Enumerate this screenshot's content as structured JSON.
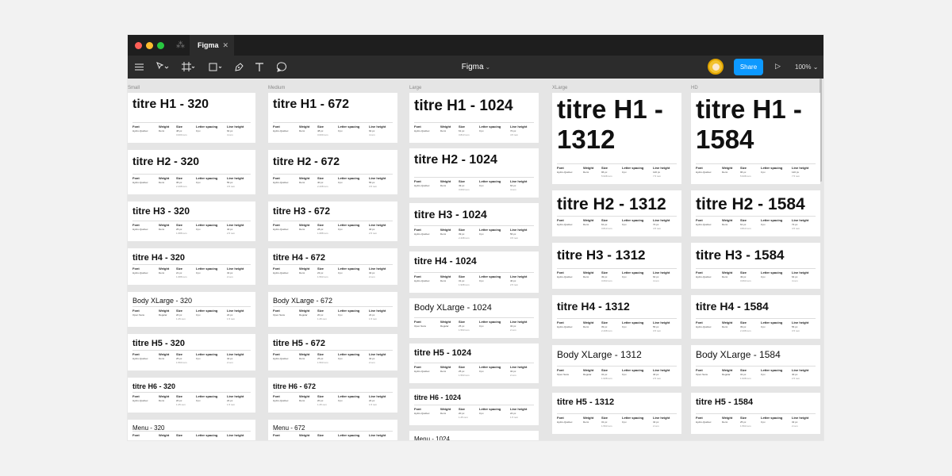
{
  "window": {
    "tab_title": "Figma",
    "tab_close": "✕",
    "logo_glyph": "⁂"
  },
  "toolbar": {
    "title": "Figma",
    "share_label": "Share",
    "zoom": "100%",
    "icons": [
      "menu-icon",
      "move-icon",
      "frame-icon",
      "shape-icon",
      "pen-icon",
      "text-icon",
      "comment-icon",
      "play-icon"
    ]
  },
  "colors": {
    "chrome": "#2c2c2c",
    "titlebar": "#1e1e1e",
    "accent": "#0d99ff",
    "canvas": "#e5e5e5"
  },
  "headers": [
    "Font",
    "Weight",
    "Size",
    "Letter spacing",
    "Line height"
  ],
  "columns": [
    {
      "label": "Small",
      "cards": [
        {
          "title": "titre H1 - 320",
          "values": [
            "Hydro-Québec",
            "Demi",
            "48 px",
            "0 px",
            "64 px"
          ],
          "subs": [
            "",
            "",
            "3.000 rem",
            "",
            "4 rem"
          ]
        },
        {
          "title": "titre H2 - 320",
          "values": [
            "Hydro-Québec",
            "Demi",
            "36 px",
            "0 px",
            "56 px"
          ],
          "subs": [
            "",
            "",
            "2.438 rem",
            "",
            "3.5 rem"
          ]
        },
        {
          "title": "titre H3 - 320",
          "values": [
            "Hydro-Québec",
            "Demi",
            "25 px",
            "0 px",
            "40 px"
          ],
          "subs": [
            "",
            "",
            "1.688 rem",
            "",
            "2.5 rem"
          ]
        },
        {
          "title": "titre H4 - 320",
          "values": [
            "Hydro-Québec",
            "Demi",
            "21 px",
            "0 px",
            "32 px"
          ],
          "subs": [
            "",
            "",
            "1.688 rem",
            "",
            "2 rem"
          ]
        },
        {
          "title": "Body XLarge - 320",
          "values": [
            "Open Sans",
            "Regular",
            "20 px",
            "0 px",
            "24 px"
          ],
          "subs": [
            "",
            "",
            "1.25 rem",
            "",
            "1.5 rem"
          ]
        },
        {
          "title": "titre H5 - 320",
          "values": [
            "Hydro-Québec",
            "Demi",
            "25 px",
            "0 px",
            "32 px"
          ],
          "subs": [
            "",
            "",
            "1.563 rem",
            "",
            "2 rem"
          ]
        },
        {
          "title": "titre H6 - 320",
          "values": [
            "Hydro-Québec",
            "Demi",
            "20 px",
            "0 px",
            "24 px"
          ],
          "subs": [
            "",
            "",
            "1.25 rem",
            "",
            "1.5 rem"
          ]
        },
        {
          "title": "Menu - 320",
          "values": [
            "",
            "",
            "",
            "",
            ""
          ],
          "subs": [
            "",
            "",
            "",
            "",
            ""
          ]
        }
      ]
    },
    {
      "label": "Medium",
      "cards": [
        {
          "title": "titre H1 - 672",
          "values": [
            "Hydro-Québec",
            "Demi",
            "48 px",
            "0 px",
            "64 px"
          ],
          "subs": [
            "",
            "",
            "3.000 rem",
            "",
            "4 rem"
          ]
        },
        {
          "title": "titre H2 - 672",
          "values": [
            "Hydro-Québec",
            "Demi",
            "40 px",
            "0 px",
            "56 px"
          ],
          "subs": [
            "",
            "",
            "2.438 rem",
            "",
            "3.5 rem"
          ]
        },
        {
          "title": "titre H3 - 672",
          "values": [
            "Hydro-Québec",
            "Demi",
            "28 px",
            "0 px",
            "40 px"
          ],
          "subs": [
            "",
            "",
            "1.688 rem",
            "",
            "2.5 rem"
          ]
        },
        {
          "title": "titre H4 - 672",
          "values": [
            "Hydro-Québec",
            "Demi",
            "23 px",
            "0 px",
            "32 px"
          ],
          "subs": [
            "",
            "",
            "1.563 rem",
            "",
            "2 rem"
          ]
        },
        {
          "title": "Body XLarge - 672",
          "values": [
            "Open Sans",
            "Regular",
            "20 px",
            "0 px",
            "24 px"
          ],
          "subs": [
            "",
            "",
            "1.25 rem",
            "",
            "1.5 rem"
          ]
        },
        {
          "title": "titre H5 - 672",
          "values": [
            "Hydro-Québec",
            "Demi",
            "25 px",
            "0 px",
            "32 px"
          ],
          "subs": [
            "",
            "",
            "1.563 rem",
            "",
            "2 rem"
          ]
        },
        {
          "title": "titre H6 - 672",
          "values": [
            "Hydro-Québec",
            "Demi",
            "20 px",
            "0 px",
            "24 px"
          ],
          "subs": [
            "",
            "",
            "1.25 rem",
            "",
            "1.5 rem"
          ]
        },
        {
          "title": "Menu - 672",
          "values": [
            "",
            "",
            "",
            "",
            ""
          ],
          "subs": [
            "",
            "",
            "",
            "",
            ""
          ]
        }
      ]
    },
    {
      "label": "Large",
      "cards": [
        {
          "title": "titre H1 - 1024",
          "values": [
            "Hydro-Québec",
            "Demi",
            "61 px",
            "0 px",
            "72 px"
          ],
          "subs": [
            "",
            "",
            "3.813 rem",
            "",
            "4.5 rem"
          ]
        },
        {
          "title": "titre H2 - 1024",
          "values": [
            "Hydro-Québec",
            "Demi",
            "49 px",
            "0 px",
            "64 px"
          ],
          "subs": [
            "",
            "",
            "3.063 rem",
            "",
            "4 rem"
          ]
        },
        {
          "title": "titre H3 - 1024",
          "values": [
            "Hydro-Québec",
            "Demi",
            "39 px",
            "0 px",
            "56 px"
          ],
          "subs": [
            "",
            "",
            "2.438 rem",
            "",
            "3.5 rem"
          ]
        },
        {
          "title": "titre H4 - 1024",
          "values": [
            "Hydro-Québec",
            "Demi",
            "31 px",
            "0 px",
            "40 px"
          ],
          "subs": [
            "",
            "",
            "1.938 rem",
            "",
            "2.5 rem"
          ]
        },
        {
          "title": "Body XLarge - 1024",
          "values": [
            "Open Sans",
            "Regular",
            "25 px",
            "0 px",
            "32 px"
          ],
          "subs": [
            "",
            "",
            "1.563 rem",
            "",
            "2 rem"
          ]
        },
        {
          "title": "titre H5 - 1024",
          "values": [
            "Hydro-Québec",
            "Demi",
            "25 px",
            "0 px",
            "32 px"
          ],
          "subs": [
            "",
            "",
            "1.563 rem",
            "",
            "2 rem"
          ]
        },
        {
          "title": "titre H6 - 1024",
          "values": [
            "Hydro-Québec",
            "Demi",
            "20 px",
            "0 px",
            "24 px"
          ],
          "subs": [
            "",
            "",
            "1.25 rem",
            "",
            "1.5 rem"
          ]
        },
        {
          "title": "Menu - 1024",
          "values": [
            "",
            "",
            "",
            "",
            ""
          ],
          "subs": [
            "",
            "",
            "",
            "",
            ""
          ]
        }
      ]
    },
    {
      "label": "XLarge",
      "cards": [
        {
          "title": "titre H1 - 1312",
          "values": [
            "Hydro-Québec",
            "Demi",
            "96 px",
            "0 px",
            "120 px"
          ],
          "subs": [
            "",
            "",
            "5.938 rem",
            "",
            "7.5 rem"
          ]
        },
        {
          "title": "titre H2 - 1312",
          "values": [
            "Hydro-Québec",
            "Demi",
            "61 px",
            "0 px",
            "72 px"
          ],
          "subs": [
            "",
            "",
            "3.813 rem",
            "",
            "4.5 rem"
          ]
        },
        {
          "title": "titre H3 - 1312",
          "values": [
            "Hydro-Québec",
            "Demi",
            "49 px",
            "0 px",
            "64 px"
          ],
          "subs": [
            "",
            "",
            "3.063 rem",
            "",
            "4 rem"
          ]
        },
        {
          "title": "titre H4 - 1312",
          "values": [
            "Hydro-Québec",
            "Demi",
            "39 px",
            "0 px",
            "56 px"
          ],
          "subs": [
            "",
            "",
            "2.438 rem",
            "",
            "3.5 rem"
          ]
        },
        {
          "title": "Body XLarge - 1312",
          "values": [
            "Open Sans",
            "Regular",
            "31 px",
            "0 px",
            "40 px"
          ],
          "subs": [
            "",
            "",
            "1.938 rem",
            "",
            "2.5 rem"
          ]
        },
        {
          "title": "titre H5 - 1312",
          "values": [
            "Hydro-Québec",
            "Demi",
            "31 px",
            "0 px",
            "32 px"
          ],
          "subs": [
            "",
            "",
            "1.563 rem",
            "",
            "2 rem"
          ]
        }
      ]
    },
    {
      "label": "HD",
      "cards": [
        {
          "title": "titre H1 - 1584",
          "values": [
            "Hydro-Québec",
            "Demi",
            "96 px",
            "0 px",
            "120 px"
          ],
          "subs": [
            "",
            "",
            "5.938 rem",
            "",
            "7.5 rem"
          ]
        },
        {
          "title": "titre H2 - 1584",
          "values": [
            "Hydro-Québec",
            "Demi",
            "61 px",
            "0 px",
            "72 px"
          ],
          "subs": [
            "",
            "",
            "3.813 rem",
            "",
            "4.5 rem"
          ]
        },
        {
          "title": "titre H3 - 1584",
          "values": [
            "Hydro-Québec",
            "Demi",
            "49 px",
            "0 px",
            "64 px"
          ],
          "subs": [
            "",
            "",
            "3.063 rem",
            "",
            "4 rem"
          ]
        },
        {
          "title": "titre H4 - 1584",
          "values": [
            "Hydro-Québec",
            "Demi",
            "39 px",
            "0 px",
            "56 px"
          ],
          "subs": [
            "",
            "",
            "2.438 rem",
            "",
            "3.5 rem"
          ]
        },
        {
          "title": "Body XLarge - 1584",
          "values": [
            "Open Sans",
            "Regular",
            "31 px",
            "0 px",
            "40 px"
          ],
          "subs": [
            "",
            "",
            "1.938 rem",
            "",
            "2.5 rem"
          ]
        },
        {
          "title": "titre H5 - 1584",
          "values": [
            "Hydro-Québec",
            "Demi",
            "25 px",
            "0 px",
            "32 px"
          ],
          "subs": [
            "",
            "",
            "1.563 rem",
            "",
            "2 rem"
          ]
        }
      ]
    }
  ]
}
